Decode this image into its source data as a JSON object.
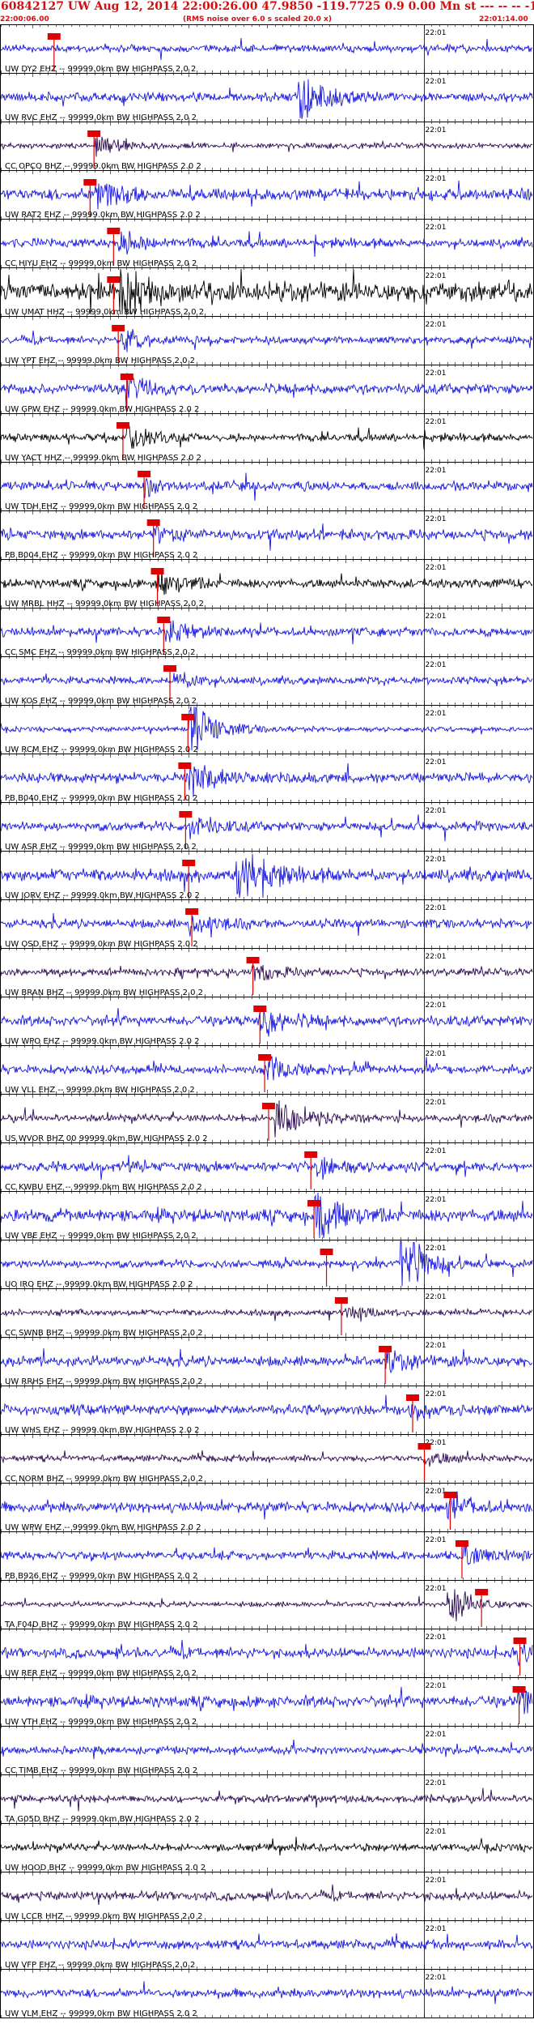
{
  "header": {
    "title": "60842127 UW Aug 12, 2014 22:00:26.00   47.9850 -119.7725  0.9 0.00 Mn st --- -- --  -1",
    "start_time": "22:00:06.00",
    "rms_note": "(RMS noise over 6.0 s scaled 20.0 x)",
    "end_time": "22:01:14.00"
  },
  "chart_data": {
    "type": "line",
    "time_start": "22:00:06.00",
    "time_end": "22:01:14.00",
    "minute_tick_label": "22:01",
    "minute_tick_time_s": 54,
    "filter": "99999.0km BW  HIGHPASS  2.0  2",
    "colors": {
      "blue": "#1515e0",
      "black": "#000000",
      "purple": "#2a0850",
      "pick": "#e00000",
      "grid": "#000000"
    },
    "traces": [
      {
        "label": "UW DY2 EHZ -- 99999.0km BW  HIGHPASS  2.0  2",
        "color": "blue",
        "pick_s": 6.8,
        "amp": 0.28,
        "burst_s": 0,
        "burst_amp": 0
      },
      {
        "label": "UW RVC EHZ -- 99999.0km BW  HIGHPASS  2.0  2",
        "color": "blue",
        "pick_s": 0,
        "amp": 0.35,
        "burst_s": 38,
        "burst_amp": 2.6
      },
      {
        "label": "CC OPCO BHZ -- 99999.0km BW  HIGHPASS  2.0  2",
        "color": "purple",
        "pick_s": 11.9,
        "amp": 0.22,
        "burst_s": 12,
        "burst_amp": 1.0
      },
      {
        "label": "UW RAT2 EHZ -- 99999.0km BW  HIGHPASS  2.0  2",
        "color": "blue",
        "pick_s": 11.4,
        "amp": 0.45,
        "burst_s": 12,
        "burst_amp": 1.6
      },
      {
        "label": "CC HIYU EHZ -- 99999.0km BW  HIGHPASS  2.0  2",
        "color": "blue",
        "pick_s": 14.4,
        "amp": 0.35,
        "burst_s": 15,
        "burst_amp": 1.3
      },
      {
        "label": "UW UMAT HHZ -- 99999.0km BW  HIGHPASS  2.0  2",
        "color": "black",
        "pick_s": 14.4,
        "amp": 0.75,
        "burst_s": 15,
        "burst_amp": 2.4
      },
      {
        "label": "UW YPT EHZ -- 99999.0km BW  HIGHPASS  2.0  2",
        "color": "blue",
        "pick_s": 15.0,
        "amp": 0.3,
        "burst_s": 15,
        "burst_amp": 1.2
      },
      {
        "label": "UW GPW EHZ -- 99999.0km BW  HIGHPASS  2.0  2",
        "color": "blue",
        "pick_s": 16.1,
        "amp": 0.4,
        "burst_s": 16,
        "burst_amp": 1.5
      },
      {
        "label": "UW YACT HHZ -- 99999.0km BW  HIGHPASS  2.0  2",
        "color": "black",
        "pick_s": 15.6,
        "amp": 0.3,
        "burst_s": 16,
        "burst_amp": 1.2
      },
      {
        "label": "UW TDH EHZ -- 99999.0km BW  HIGHPASS  2.0  2",
        "color": "blue",
        "pick_s": 18.3,
        "amp": 0.35,
        "burst_s": 18,
        "burst_amp": 0.8
      },
      {
        "label": "PB B004 EHZ -- 99999.0km BW  HIGHPASS  2.0  2",
        "color": "blue",
        "pick_s": 19.5,
        "amp": 0.4,
        "burst_s": 19,
        "burst_amp": 0.9
      },
      {
        "label": "UW MRBL HHZ -- 99999.0km BW  HIGHPASS  2.0  2",
        "color": "black",
        "pick_s": 20.0,
        "amp": 0.35,
        "burst_s": 20,
        "burst_amp": 1.4
      },
      {
        "label": "CC SMC EHZ -- 99999.0km BW  HIGHPASS  2.0  2",
        "color": "blue",
        "pick_s": 20.8,
        "amp": 0.35,
        "burst_s": 21,
        "burst_amp": 0.9
      },
      {
        "label": "UW KOS EHZ -- 99999.0km BW  HIGHPASS  2.0  2",
        "color": "blue",
        "pick_s": 21.6,
        "amp": 0.3,
        "burst_s": 22,
        "burst_amp": 0.8
      },
      {
        "label": "UW RCM EHZ -- 99999.0km BW  HIGHPASS  2.0  2",
        "color": "blue",
        "pick_s": 23.9,
        "amp": 0.2,
        "burst_s": 24,
        "burst_amp": 3.0
      },
      {
        "label": "PB B040 EHZ -- 99999.0km BW  HIGHPASS  2.0  2",
        "color": "blue",
        "pick_s": 23.5,
        "amp": 0.4,
        "burst_s": 24,
        "burst_amp": 1.8
      },
      {
        "label": "UW ASR EHZ -- 99999.0km BW  HIGHPASS  2.0  2",
        "color": "blue",
        "pick_s": 23.6,
        "amp": 0.35,
        "burst_s": 24,
        "burst_amp": 1.1
      },
      {
        "label": "UW JORV EHZ -- 99999.0km BW  HIGHPASS  2.0  2",
        "color": "blue",
        "pick_s": 24.0,
        "amp": 0.5,
        "burst_s": 30,
        "burst_amp": 3.2
      },
      {
        "label": "UW OSD EHZ -- 99999.0km BW  HIGHPASS  2.0  2",
        "color": "blue",
        "pick_s": 24.4,
        "amp": 0.35,
        "burst_s": 24,
        "burst_amp": 1.0
      },
      {
        "label": "UW BRAN BHZ -- 99999.0km BW  HIGHPASS  2.0  2",
        "color": "purple",
        "pick_s": 32.2,
        "amp": 0.3,
        "burst_s": 32,
        "burst_amp": 0.8
      },
      {
        "label": "UW WPO EHZ -- 99999.0km BW  HIGHPASS  2.0  2",
        "color": "blue",
        "pick_s": 33.1,
        "amp": 0.4,
        "burst_s": 33,
        "burst_amp": 1.5
      },
      {
        "label": "UW VLL EHZ -- 99999.0km BW  HIGHPASS  2.0  2",
        "color": "blue",
        "pick_s": 33.7,
        "amp": 0.35,
        "burst_s": 34,
        "burst_amp": 1.6
      },
      {
        "label": "US WVOR BHZ 00 99999.0km BW  HIGHPASS  2.0  2",
        "color": "purple",
        "pick_s": 34.2,
        "amp": 0.3,
        "burst_s": 35,
        "burst_amp": 2.0
      },
      {
        "label": "CC KWBU EHZ -- 99999.0km BW  HIGHPASS  2.0  2",
        "color": "blue",
        "pick_s": 39.6,
        "amp": 0.4,
        "burst_s": 40,
        "burst_amp": 1.0
      },
      {
        "label": "UW VBE EHZ -- 99999.0km BW  HIGHPASS  2.0  2",
        "color": "blue",
        "pick_s": 40.0,
        "amp": 0.5,
        "burst_s": 40,
        "burst_amp": 3.2
      },
      {
        "label": "UO IRO EHZ -- 99999.0km BW  HIGHPASS  2.0  2",
        "color": "blue",
        "pick_s": 41.6,
        "amp": 0.3,
        "burst_s": 51,
        "burst_amp": 3.2
      },
      {
        "label": "CC SWNB BHZ -- 99999.0km BW  HIGHPASS  2.0  2",
        "color": "purple",
        "pick_s": 43.5,
        "amp": 0.25,
        "burst_s": 44,
        "burst_amp": 0.6
      },
      {
        "label": "UW RRHS EHZ -- 99999.0km BW  HIGHPASS  2.0  2",
        "color": "blue",
        "pick_s": 49.1,
        "amp": 0.4,
        "burst_s": 49,
        "burst_amp": 0.9
      },
      {
        "label": "UW WHS EHZ -- 99999.0km BW  HIGHPASS  2.0  2",
        "color": "blue",
        "pick_s": 52.6,
        "amp": 0.4,
        "burst_s": 52,
        "burst_amp": 0.9
      },
      {
        "label": "CC NORM BHZ -- 99999.0km BW  HIGHPASS  2.0  2",
        "color": "purple",
        "pick_s": 54.1,
        "amp": 0.25,
        "burst_s": 54,
        "burst_amp": 0.6
      },
      {
        "label": "UW WPW EHZ -- 99999.0km BW  HIGHPASS  2.0  2",
        "color": "blue",
        "pick_s": 57.4,
        "amp": 0.4,
        "burst_s": 57,
        "burst_amp": 1.2
      },
      {
        "label": "PB B926 EHZ -- 99999.0km BW  HIGHPASS  2.0  2",
        "color": "blue",
        "pick_s": 58.9,
        "amp": 0.35,
        "burst_s": 59,
        "burst_amp": 1.0
      },
      {
        "label": "TA F04D BHZ -- 99999.0km BW  HIGHPASS  2.0  2",
        "color": "purple",
        "pick_s": 61.4,
        "amp": 0.2,
        "burst_s": 57,
        "burst_amp": 1.8
      },
      {
        "label": "UW RER EHZ -- 99999.0km BW  HIGHPASS  2.0  2",
        "color": "blue",
        "pick_s": 66.3,
        "amp": 0.4,
        "burst_s": 66,
        "burst_amp": 1.0
      },
      {
        "label": "UW VTH EHZ -- 99999.0km BW  HIGHPASS  2.0  2",
        "color": "blue",
        "pick_s": 66.2,
        "amp": 0.45,
        "burst_s": 66,
        "burst_amp": 1.4
      },
      {
        "label": "CC TIMB EHZ -- 99999.0km BW  HIGHPASS  2.0  2",
        "color": "blue",
        "pick_s": 0,
        "amp": 0.3,
        "burst_s": 0,
        "burst_amp": 0
      },
      {
        "label": "TA G05D BHZ -- 99999.0km BW  HIGHPASS  2.0  2",
        "color": "purple",
        "pick_s": 0,
        "amp": 0.3,
        "burst_s": 0,
        "burst_amp": 0
      },
      {
        "label": "UW HOOD BHZ -- 99999.0km BW  HIGHPASS  2.0  2",
        "color": "black",
        "pick_s": 0,
        "amp": 0.3,
        "burst_s": 0,
        "burst_amp": 0
      },
      {
        "label": "UW LCCR HHZ -- 99999.0km BW  HIGHPASS  2.0  2",
        "color": "purple",
        "pick_s": 0,
        "amp": 0.35,
        "burst_s": 0,
        "burst_amp": 0
      },
      {
        "label": "UW VFP EHZ -- 99999.0km BW  HIGHPASS  2.0  2",
        "color": "blue",
        "pick_s": 0,
        "amp": 0.35,
        "burst_s": 0,
        "burst_amp": 0
      },
      {
        "label": "UW VLM EHZ -- 99999.0km BW  HIGHPASS  2.0  2",
        "color": "blue",
        "pick_s": 0,
        "amp": 0.35,
        "burst_s": 0,
        "burst_amp": 0
      }
    ]
  }
}
